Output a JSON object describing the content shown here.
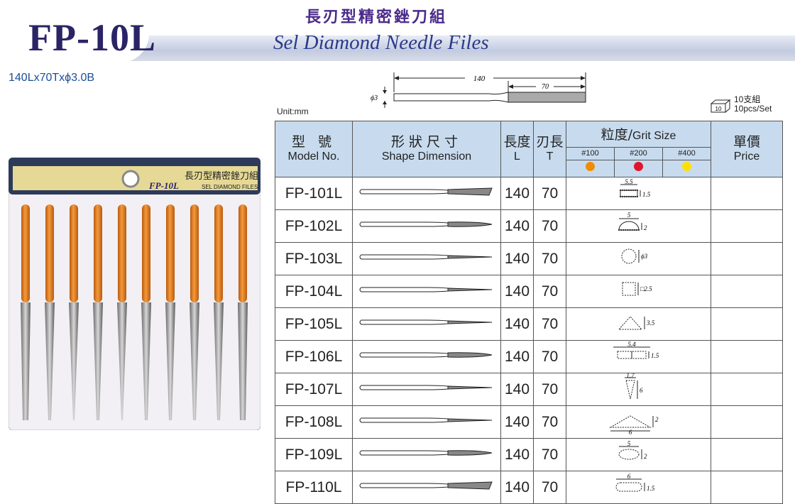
{
  "header": {
    "model": "FP-10L",
    "title_zh": "長刃型精密銼刀組",
    "title_en": "Sel Diamond Needle Files",
    "spec": "140Lx70Txϕ3.0B"
  },
  "dimension": {
    "total_length": "140",
    "blade_length": "70",
    "diameter": "ϕ3"
  },
  "unit_label": "Unit:mm",
  "pack": {
    "count_zh": "10支組",
    "count_en": "10pcs/Set",
    "box_label": "10"
  },
  "package_photo": {
    "label_zh": "長刃型精密銼刀組",
    "label_model": "FP-10L",
    "label_en": "SEL DIAMOND FILES"
  },
  "table": {
    "headers": {
      "model_zh": "型 號",
      "model_en": "Model No.",
      "shape_zh": "形狀尺寸",
      "shape_en": "Shape Dimension",
      "length_zh": "長度",
      "length_en": "L",
      "blade_zh": "刃長",
      "blade_en": "T",
      "grit_zh": "粒度/",
      "grit_en": "Grit Size",
      "price_zh": "單價",
      "price_en": "Price"
    },
    "grits": [
      {
        "label": "#100",
        "color": "#f08c00"
      },
      {
        "label": "#200",
        "color": "#e0142a"
      },
      {
        "label": "#400",
        "color": "#ffe000"
      }
    ],
    "rows": [
      {
        "model": "FP-101L",
        "L": "140",
        "T": "70",
        "section": "flat",
        "dims": [
          "5.5",
          "1.5"
        ]
      },
      {
        "model": "FP-102L",
        "L": "140",
        "T": "70",
        "section": "half-round",
        "dims": [
          "5",
          "2"
        ]
      },
      {
        "model": "FP-103L",
        "L": "140",
        "T": "70",
        "section": "round",
        "dims": [
          "ϕ3"
        ]
      },
      {
        "model": "FP-104L",
        "L": "140",
        "T": "70",
        "section": "square",
        "dims": [
          "□2.5"
        ]
      },
      {
        "model": "FP-105L",
        "L": "140",
        "T": "70",
        "section": "triangle",
        "dims": [
          "3.5"
        ]
      },
      {
        "model": "FP-106L",
        "L": "140",
        "T": "70",
        "section": "equaling",
        "dims": [
          "5.4",
          "1.5"
        ]
      },
      {
        "model": "FP-107L",
        "L": "140",
        "T": "70",
        "section": "knife",
        "dims": [
          "1.7",
          "6"
        ]
      },
      {
        "model": "FP-108L",
        "L": "140",
        "T": "70",
        "section": "barrette",
        "dims": [
          "2",
          "6"
        ]
      },
      {
        "model": "FP-109L",
        "L": "140",
        "T": "70",
        "section": "crossing",
        "dims": [
          "5",
          "2"
        ]
      },
      {
        "model": "FP-110L",
        "L": "140",
        "T": "70",
        "section": "oval",
        "dims": [
          "6",
          "1.5"
        ]
      }
    ]
  },
  "colors": {
    "navy": "#2a2466",
    "header_bg": "#c8dbee",
    "handle": "#e87a18",
    "blue_text": "#1a4f95"
  }
}
